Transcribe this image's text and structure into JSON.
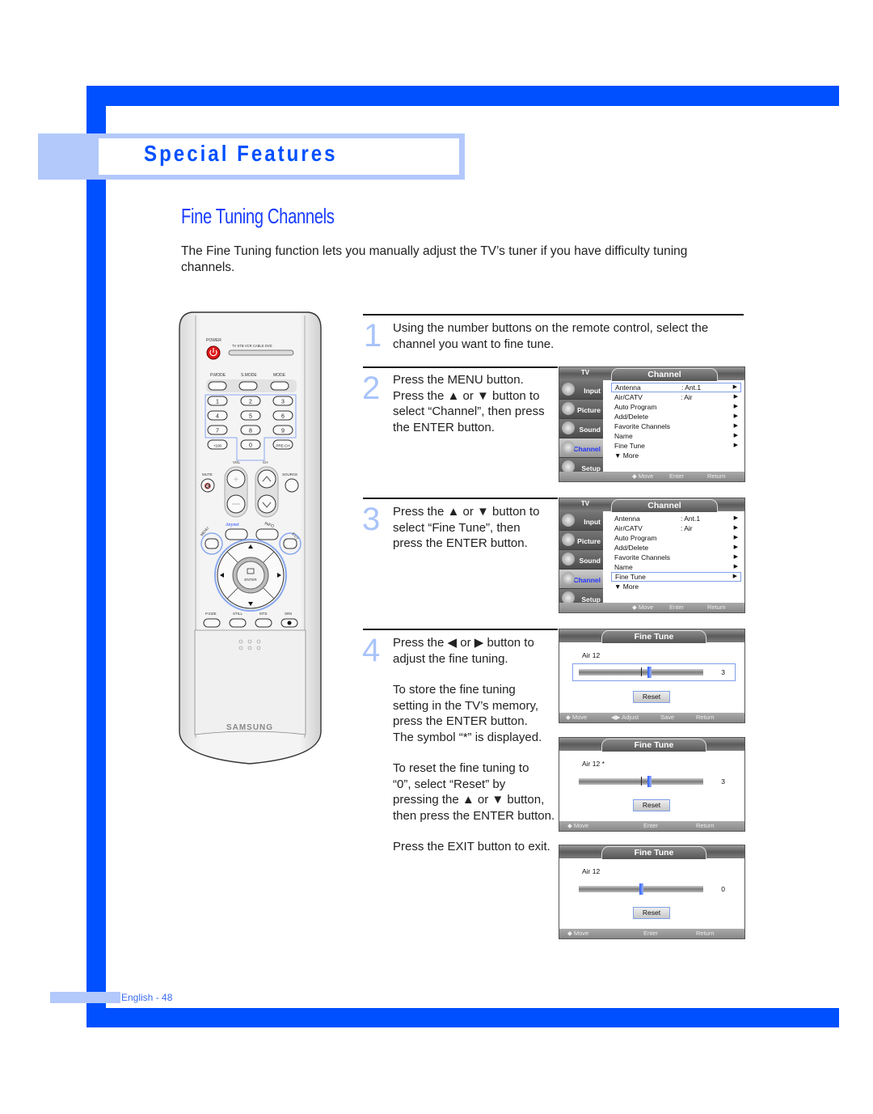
{
  "section": {
    "title": "Special Features"
  },
  "page": {
    "title": "Fine Tuning Channels",
    "intro": "The Fine Tuning function lets you manually adjust the TV’s tuner if you have difficulty tuning channels."
  },
  "steps": [
    {
      "number": "1",
      "lines": [
        "Using the number buttons on the remote control, select the",
        "channel you want to fine tune."
      ]
    },
    {
      "number": "2",
      "lines": [
        "Press the MENU button.",
        "Press the ▲ or ▼ button to",
        "select “Channel”, then press",
        "the ENTER button."
      ]
    },
    {
      "number": "3",
      "lines": [
        "Press the ▲ or ▼ button to",
        "select “Fine Tune”, then",
        "press the ENTER button."
      ]
    },
    {
      "number": "4",
      "lines": [
        "Press the ◀ or ▶ button to",
        "adjust the fine tuning."
      ],
      "store": [
        "To store the fine tuning",
        "setting in the TV’s memory,",
        "press the ENTER button.",
        "The symbol “*” is displayed."
      ],
      "reset": [
        "To reset the fine tuning to",
        "“0”, select “Reset” by",
        "pressing the ▲ or ▼ button,",
        "then press the ENTER button."
      ],
      "exit": "Press the EXIT button to exit."
    }
  ],
  "remote": {
    "brand": "SAMSUNG",
    "power": "POWER",
    "modes": [
      "TV",
      "STB",
      "VCR",
      "CABLE",
      "DVD"
    ],
    "mode_buttons": [
      "P.MODE",
      "S.MODE",
      "MODE"
    ],
    "numbers": [
      "1",
      "2",
      "3",
      "4",
      "5",
      "6",
      "7",
      "8",
      "9",
      "+100",
      "0",
      "PRE-CH"
    ],
    "vol": "VOL",
    "ch": "CH",
    "mute": "MUTE",
    "source": "SOURCE",
    "anynet": "Anynet",
    "info": "INFO",
    "menu": "MENU",
    "exit": "EXIT",
    "enter": "ENTER",
    "bottom_buttons": [
      "P.SIZE",
      "STILL",
      "MTS",
      "SRS"
    ]
  },
  "osd_channel": {
    "tv_label": "TV",
    "title": "Channel",
    "sidebar": [
      "Input",
      "Picture",
      "Sound",
      "Channel",
      "Setup"
    ],
    "active_sidebar": "Channel",
    "items": [
      {
        "label": "Antenna",
        "value": ": Ant.1",
        "arrow": "▶"
      },
      {
        "label": "Air/CATV",
        "value": ": Air",
        "arrow": "▶"
      },
      {
        "label": "Auto Program",
        "value": "",
        "arrow": "▶"
      },
      {
        "label": "Add/Delete",
        "value": "",
        "arrow": "▶"
      },
      {
        "label": "Favorite Channels",
        "value": "",
        "arrow": "▶"
      },
      {
        "label": "Name",
        "value": "",
        "arrow": "▶"
      },
      {
        "label": "Fine Tune",
        "value": "",
        "arrow": "▶"
      },
      {
        "label": "▼ More",
        "value": "",
        "arrow": ""
      }
    ],
    "footer": [
      "◆ Move",
      "Enter",
      "Return"
    ],
    "screens": [
      {
        "selected_item": "Antenna"
      },
      {
        "selected_item": "Fine Tune"
      }
    ]
  },
  "osd_finetune": {
    "title": "Fine Tune",
    "reset_label": "Reset",
    "screens": [
      {
        "channel": "Air 12",
        "value": "3",
        "level": 3,
        "footer": [
          "◆ Move",
          "◀▶ Adjust",
          "Save",
          "Return"
        ]
      },
      {
        "channel": "Air 12 *",
        "value": "3",
        "level": 3,
        "footer": [
          "◆ Move",
          "Enter",
          "Return"
        ]
      },
      {
        "channel": "Air 12",
        "value": "0",
        "level": 0,
        "footer": [
          "◆ Move",
          "Enter",
          "Return"
        ]
      }
    ]
  },
  "footer": {
    "page_label": "English - 48"
  }
}
